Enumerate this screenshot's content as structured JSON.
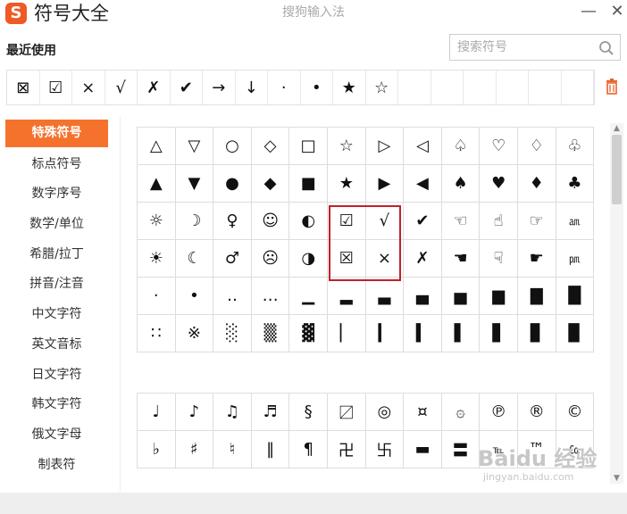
{
  "window": {
    "logo_letter": "S",
    "title": "符号大全",
    "ime_name": "搜狗输入法",
    "minimize": "—",
    "close": "✕"
  },
  "recent": {
    "label": "最近使用",
    "symbols": [
      "⊠",
      "☑",
      "×",
      "√",
      "✗",
      "✔",
      "→",
      "↓",
      "·",
      "•",
      "★",
      "☆",
      "",
      "",
      "",
      "",
      "",
      ""
    ]
  },
  "search": {
    "placeholder": "搜索符号",
    "icon": "search-icon"
  },
  "trash_icon": "trash-icon",
  "sidebar": {
    "items": [
      "特殊符号",
      "标点符号",
      "数字序号",
      "数学/单位",
      "希腊/拉丁",
      "拼音/注音",
      "中文字符",
      "英文音标",
      "日文字符",
      "韩文字符",
      "俄文字母",
      "制表符"
    ],
    "active_index": 0
  },
  "symbols_section1": [
    "△",
    "▽",
    "○",
    "◇",
    "□",
    "☆",
    "▷",
    "◁",
    "♤",
    "♡",
    "♢",
    "♧",
    "▲",
    "▼",
    "●",
    "◆",
    "■",
    "★",
    "▶",
    "◀",
    "♠",
    "♥",
    "♦",
    "♣",
    "☼",
    "☽",
    "♀",
    "☺",
    "◐",
    "☑",
    "√",
    "✔",
    "☜",
    "☝",
    "☞",
    "㏂",
    "☀",
    "☾",
    "♂",
    "☹",
    "◑",
    "☒",
    "×",
    "✗",
    "☚",
    "☟",
    "☛",
    "㏘",
    "·",
    "•",
    "‥",
    "…",
    "▁",
    "▂",
    "▃",
    "▄",
    "▅",
    "▆",
    "▇",
    "█",
    "∷",
    "※",
    "░",
    "▒",
    "▓",
    "▏",
    "▎",
    "▍",
    "▌",
    "▋",
    "▊",
    "▉"
  ],
  "symbols_section2": [
    "♩",
    "♪",
    "♫",
    "♬",
    "§",
    "〼",
    "◎",
    "¤",
    "۞",
    "℗",
    "®",
    "©",
    "♭",
    "♯",
    "♮",
    "‖",
    "¶",
    "卍",
    "卐",
    "▬",
    "〓",
    "℡",
    "™",
    "㏇"
  ],
  "watermark": {
    "line1": "Baidu 经验",
    "line2": "jingyan.baidu.com"
  },
  "colors": {
    "accent": "#f5722d",
    "highlight_box": "#c0202a",
    "logo": "#ef5a24"
  }
}
